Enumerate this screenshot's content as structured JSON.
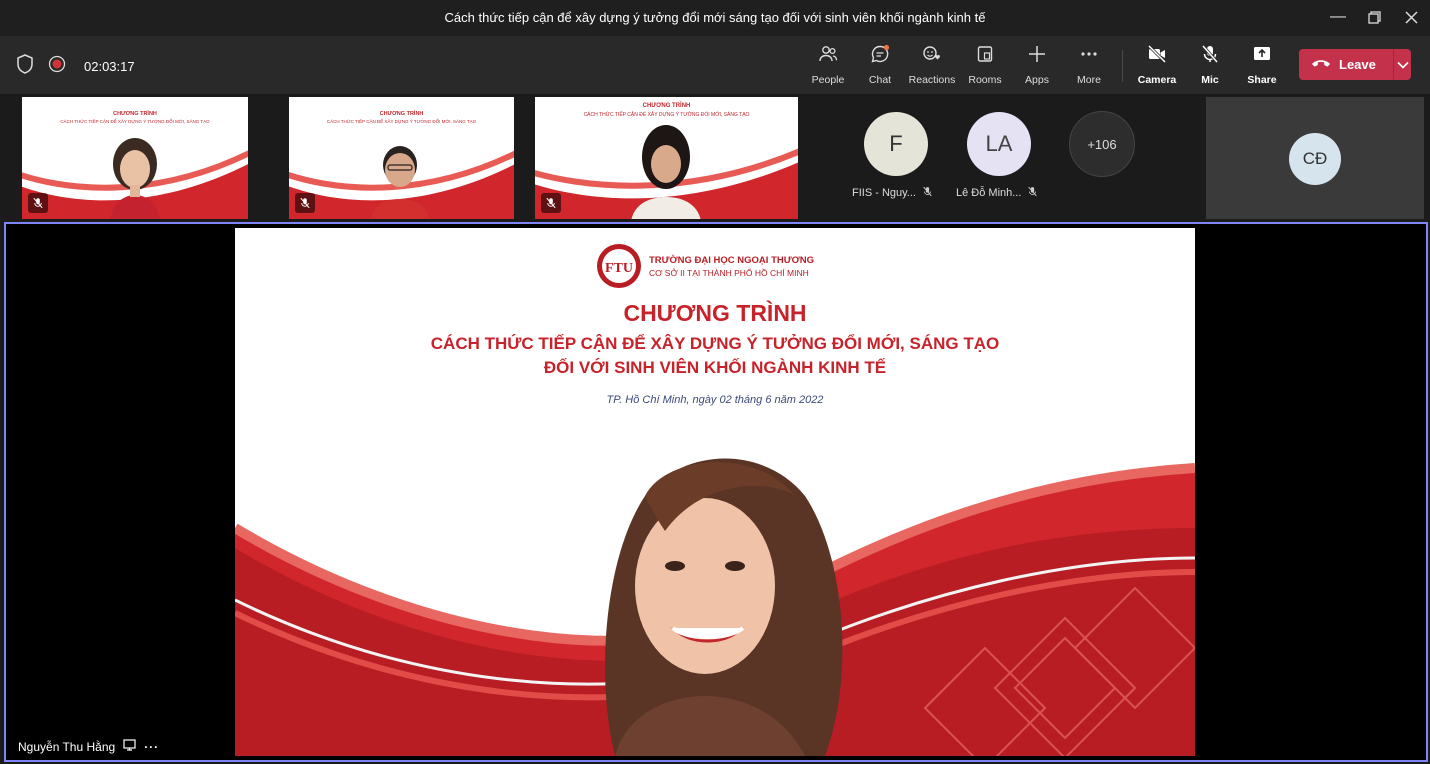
{
  "window": {
    "title": "Cách thức tiếp cận để xây dựng ý tưởng đổi mới sáng tạo đối với sinh viên khối ngành kinh tế"
  },
  "meeting": {
    "timer": "02:03:17"
  },
  "toolbar": {
    "people": "People",
    "chat": "Chat",
    "reactions": "Reactions",
    "rooms": "Rooms",
    "apps": "Apps",
    "more": "More",
    "camera": "Camera",
    "mic": "Mic",
    "share": "Share",
    "leave": "Leave"
  },
  "participants": {
    "f": {
      "initials": "F",
      "name": "FIIS - Nguy..."
    },
    "la": {
      "initials": "LA",
      "name": "Lê Đỗ Minh..."
    },
    "overflow": "+106",
    "cd": {
      "initials": "CĐ"
    }
  },
  "slide": {
    "school": "TRƯỜNG ĐẠI HỌC NGOẠI THƯƠNG",
    "campus": "CƠ SỞ II TẠI THÀNH PHỐ HỒ CHÍ MINH",
    "heading": "CHƯƠNG TRÌNH",
    "line1": "CÁCH THỨC TIẾP CẬN ĐỂ XÂY DỰNG Ý TƯỞNG ĐỔI MỚI, SÁNG TẠO",
    "line2": "ĐỐI VỚI SINH VIÊN KHỐI NGÀNH KINH TẾ",
    "date": "TP. Hồ Chí Minh, ngày 02 tháng 6 năm 2022"
  },
  "speaker": {
    "name": "Nguyễn Thu Hằng"
  },
  "colors": {
    "leave": "#c4314b",
    "stage_border": "#7f85f5",
    "brand_red": "#d0262c"
  }
}
